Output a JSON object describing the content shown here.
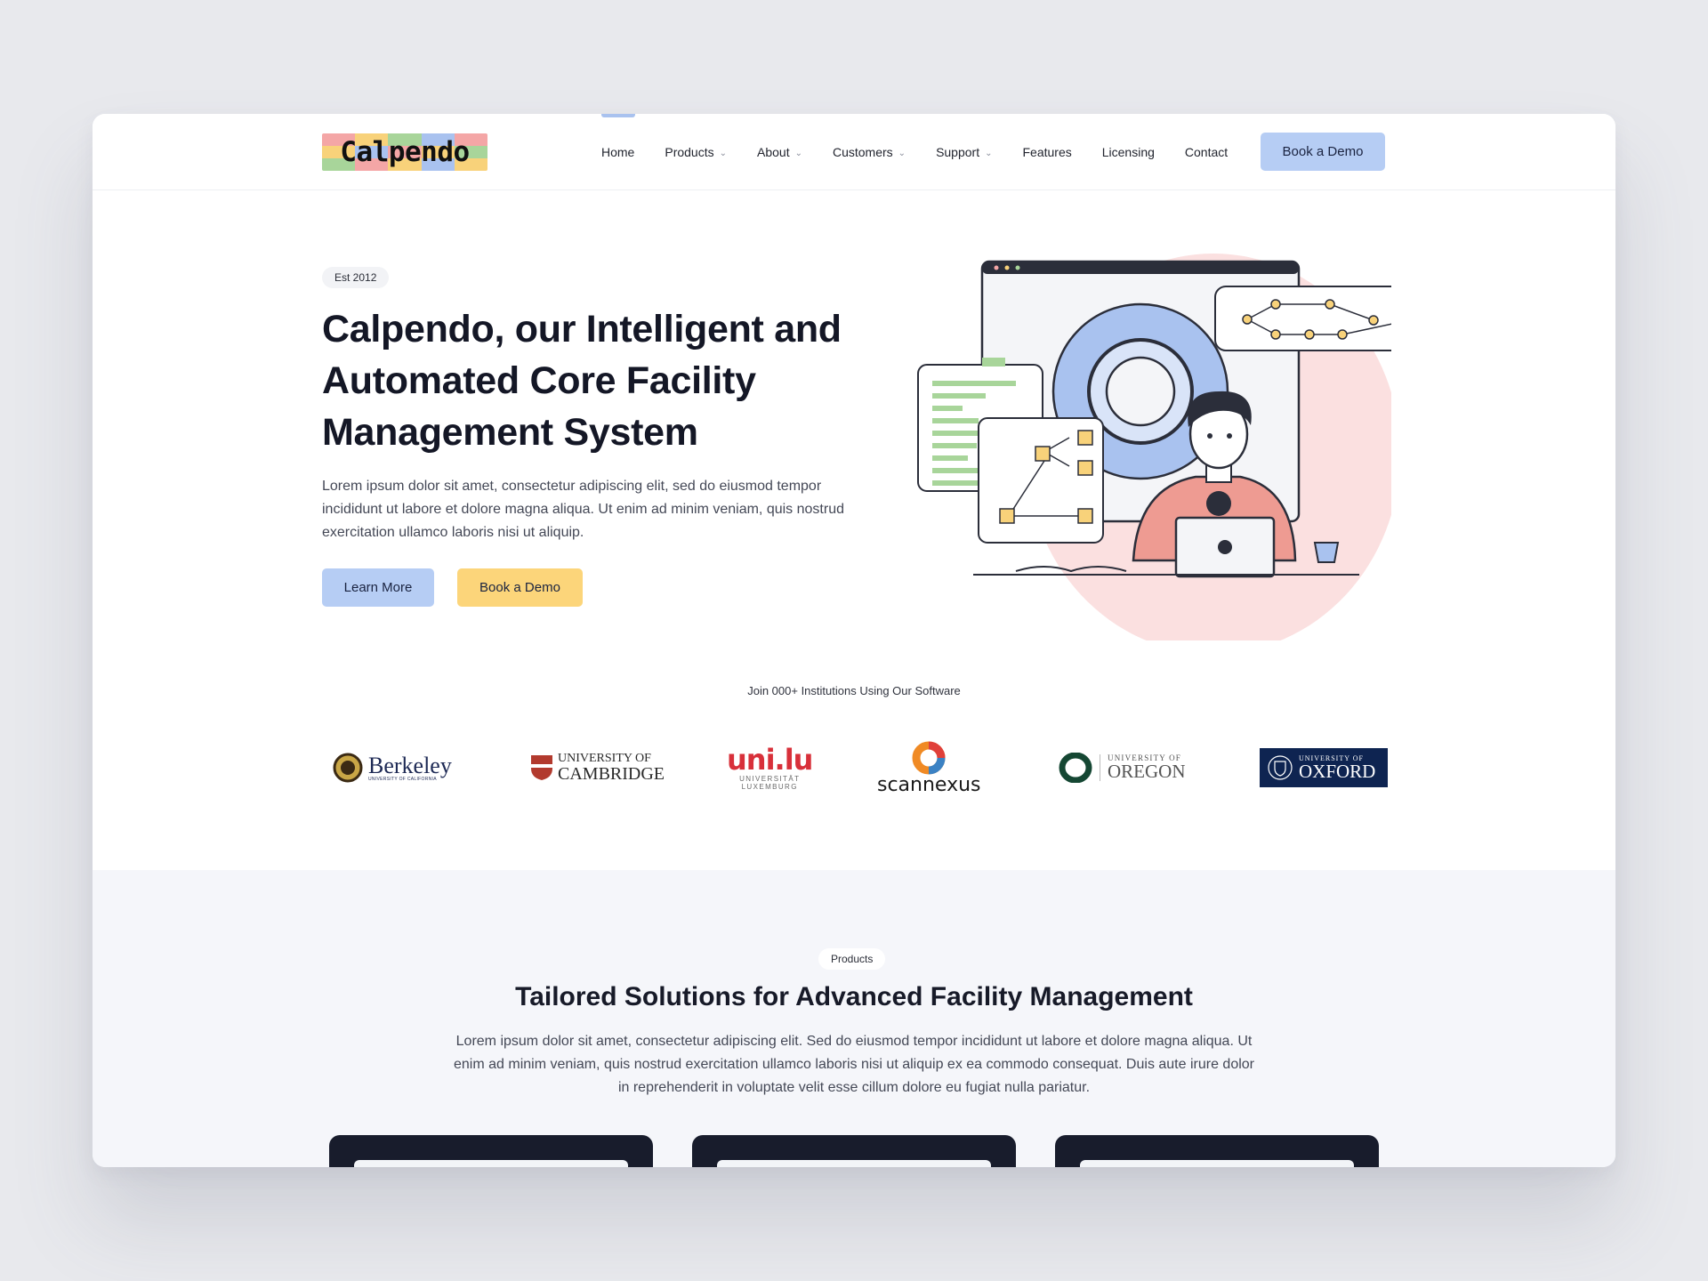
{
  "nav": {
    "logo_text": "Calpendo",
    "items": [
      {
        "label": "Home",
        "dropdown": false
      },
      {
        "label": "Products",
        "dropdown": true
      },
      {
        "label": "About",
        "dropdown": true
      },
      {
        "label": "Customers",
        "dropdown": true
      },
      {
        "label": "Support",
        "dropdown": true
      },
      {
        "label": "Features",
        "dropdown": false
      },
      {
        "label": "Licensing",
        "dropdown": false
      },
      {
        "label": "Contact",
        "dropdown": false
      }
    ],
    "cta": "Book a Demo"
  },
  "hero": {
    "badge": "Est 2012",
    "title": "Calpendo, our Intelligent and Automated Core Facility Management System",
    "text": "Lorem ipsum dolor sit amet, consectetur adipiscing elit, sed do eiusmod tempor incididunt ut labore et dolore magna aliqua. Ut enim ad minim veniam, quis nostrud exercitation ullamco laboris nisi ut aliquip.",
    "learn_more": "Learn More",
    "book_demo": "Book a Demo"
  },
  "institutions": {
    "heading": "Join 000+ Institutions Using Our Software",
    "logos": [
      {
        "name": "berkeley",
        "line1": "Berkeley",
        "line2": "UNIVERSITY OF CALIFORNIA"
      },
      {
        "name": "cambridge",
        "line1": "UNIVERSITY OF",
        "line2": "CAMBRIDGE"
      },
      {
        "name": "luxembourg",
        "line1": "uni.lu",
        "line2": "UNIVERSITÄT",
        "line3": "LUXEMBURG"
      },
      {
        "name": "scannexus",
        "line1": "scannexus"
      },
      {
        "name": "oregon",
        "line1": "UNIVERSITY OF",
        "line2": "OREGON"
      },
      {
        "name": "oxford",
        "line1": "UNIVERSITY OF",
        "line2": "OXFORD"
      }
    ]
  },
  "products": {
    "pill": "Products",
    "title": "Tailored Solutions for Advanced Facility Management",
    "text": "Lorem ipsum dolor sit amet, consectetur adipiscing elit. Sed do eiusmod  tempor incididunt ut labore et dolore magna aliqua. Ut enim ad minim  veniam, quis nostrud exercitation ullamco laboris nisi ut aliquip ex ea  commodo consequat. Duis aute irure dolor in reprehenderit in voluptate velit esse cillum dolore eu fugiat nulla pariatur."
  },
  "colors": {
    "primary_button": "#b6cdf4",
    "accent_button": "#fcd57a",
    "dark": "#141726"
  }
}
